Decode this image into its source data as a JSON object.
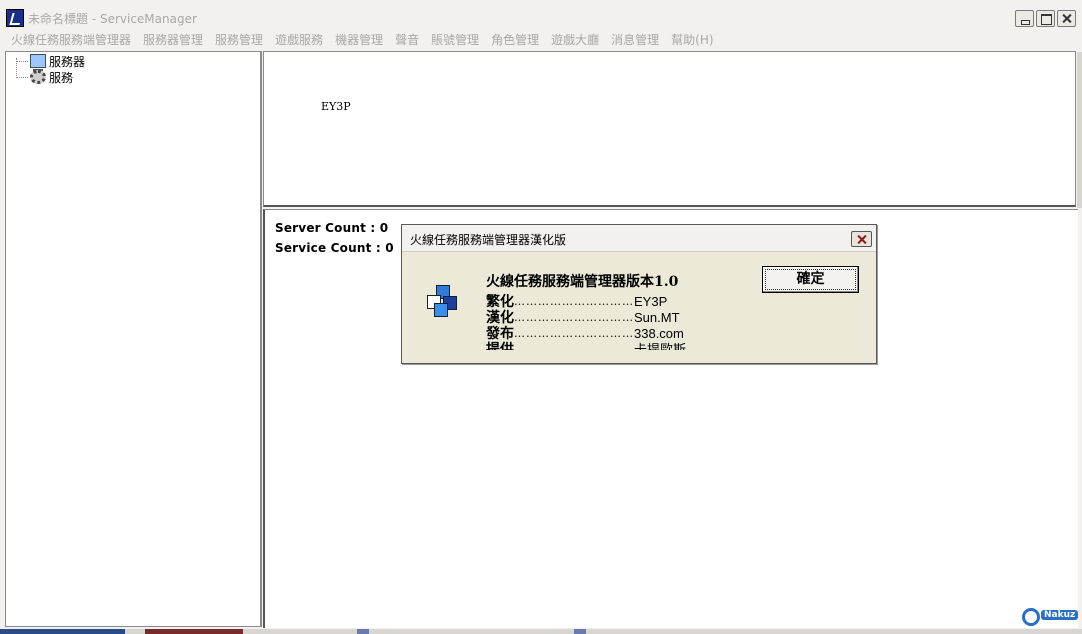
{
  "window": {
    "title": "未命名標題 - ServiceManager"
  },
  "menubar": {
    "items": [
      {
        "label": "火線任務服務端管理器"
      },
      {
        "label": "服務器管理"
      },
      {
        "label": "服務管理"
      },
      {
        "label": "遊戲服務"
      },
      {
        "label": "機器管理"
      },
      {
        "label": "聲音"
      },
      {
        "label": "賬號管理"
      },
      {
        "label": "角色管理"
      },
      {
        "label": "遊戲大廳"
      },
      {
        "label": "消息管理"
      },
      {
        "label": "幫助(H)"
      }
    ]
  },
  "tree": {
    "items": [
      {
        "label": "服務器",
        "icon": "computer-icon"
      },
      {
        "label": "服務",
        "icon": "gears-icon"
      }
    ]
  },
  "top_pane": {
    "text": "EY3P"
  },
  "bottom_pane": {
    "server_count": "Server Count : 0",
    "service_count": "Service Count : 0"
  },
  "dialog": {
    "title": "火線任務服務端管理器漢化版",
    "heading": "火線任務服務端管理器版本1.0",
    "ok_label": "確定",
    "lines": [
      {
        "key": "繁化",
        "dots": "…………………………",
        "value": "EY3P"
      },
      {
        "key": "漢化",
        "dots": "…………………………",
        "value": "Sun.MT"
      },
      {
        "key": "發布",
        "dots": "…………………………",
        "value": "338.com"
      },
      {
        "key": "提供",
        "dots": "…………………………",
        "value": "卡提歐斯"
      }
    ]
  },
  "watermark": {
    "text": "Nakuz"
  }
}
